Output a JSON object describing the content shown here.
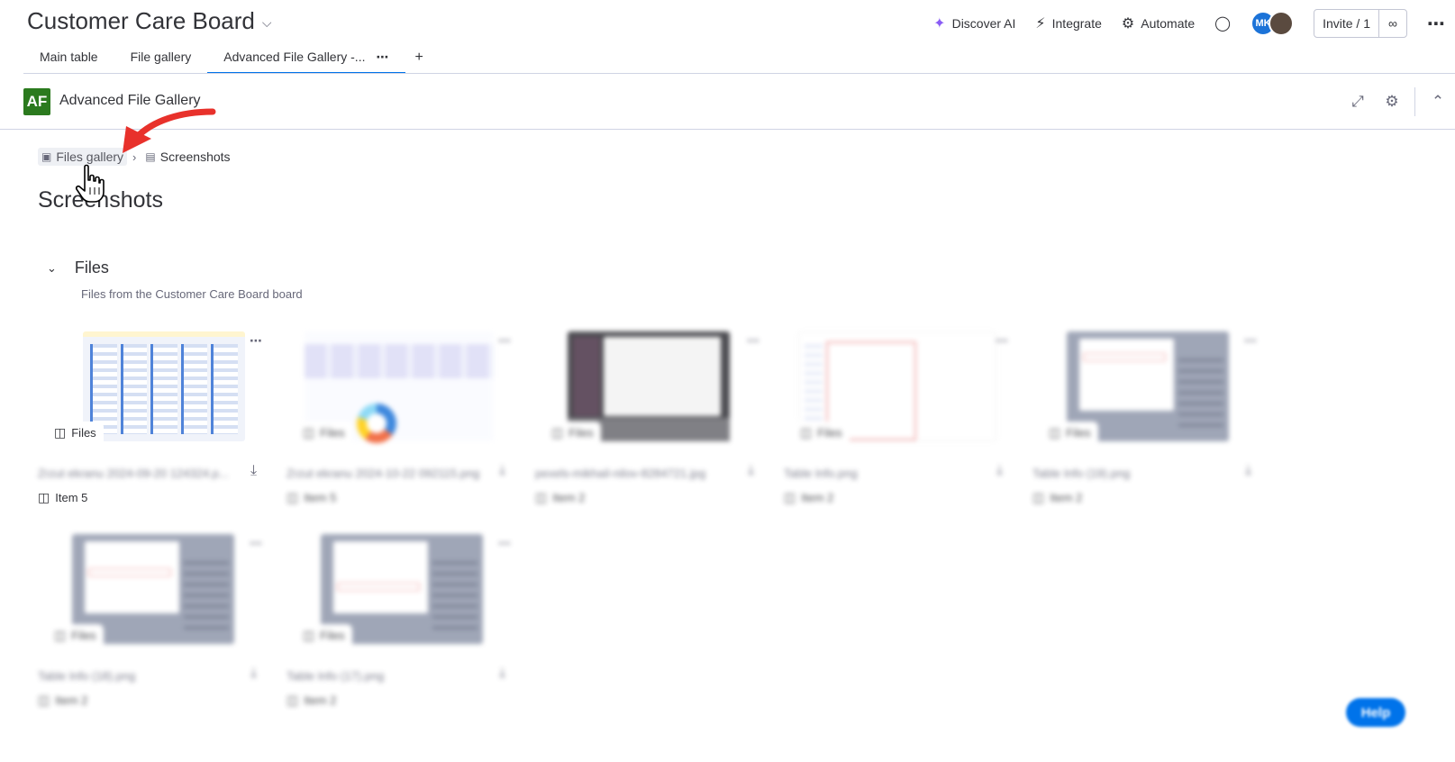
{
  "header": {
    "board_title": "Customer Care Board",
    "actions": {
      "discover_ai": "Discover AI",
      "integrate": "Integrate",
      "automate": "Automate"
    },
    "avatar_initials": "MK",
    "invite_label": "Invite / 1"
  },
  "tabs": [
    {
      "label": "Main table"
    },
    {
      "label": "File gallery"
    },
    {
      "label": "Advanced File Gallery -..."
    }
  ],
  "app": {
    "logo_text": "AF",
    "name": "Advanced File Gallery",
    "logo_color": "#2b7a1e"
  },
  "breadcrumb": {
    "parent": "Files gallery",
    "current": "Screenshots"
  },
  "page_title": "Screenshots",
  "group": {
    "title": "Files",
    "subtitle": "Files from the Customer Care Board board"
  },
  "cards": [
    {
      "badge": "Files",
      "file_name": "Zrzut ekranu 2024-09-20 124324.p...",
      "item": "Item 5"
    },
    {
      "badge": "Files",
      "file_name": "Zrzut ekranu 2024-10-22 092115.png",
      "item": "Item 5"
    },
    {
      "badge": "Files",
      "file_name": "pexels-mikhail-nilov-8284721.jpg",
      "item": "Item 2"
    },
    {
      "badge": "Files",
      "file_name": "Table Info.png",
      "item": "Item 2"
    },
    {
      "badge": "Files",
      "file_name": "Table Info (19).png",
      "item": "Item 2"
    },
    {
      "badge": "Files",
      "file_name": "Table Info (18).png",
      "item": "Item 2"
    },
    {
      "badge": "Files",
      "file_name": "Table Info (17).png",
      "item": "Item 2"
    }
  ],
  "help_label": "Help",
  "colors": {
    "accent": "#0073ea",
    "annotation_arrow": "#e8312b"
  }
}
